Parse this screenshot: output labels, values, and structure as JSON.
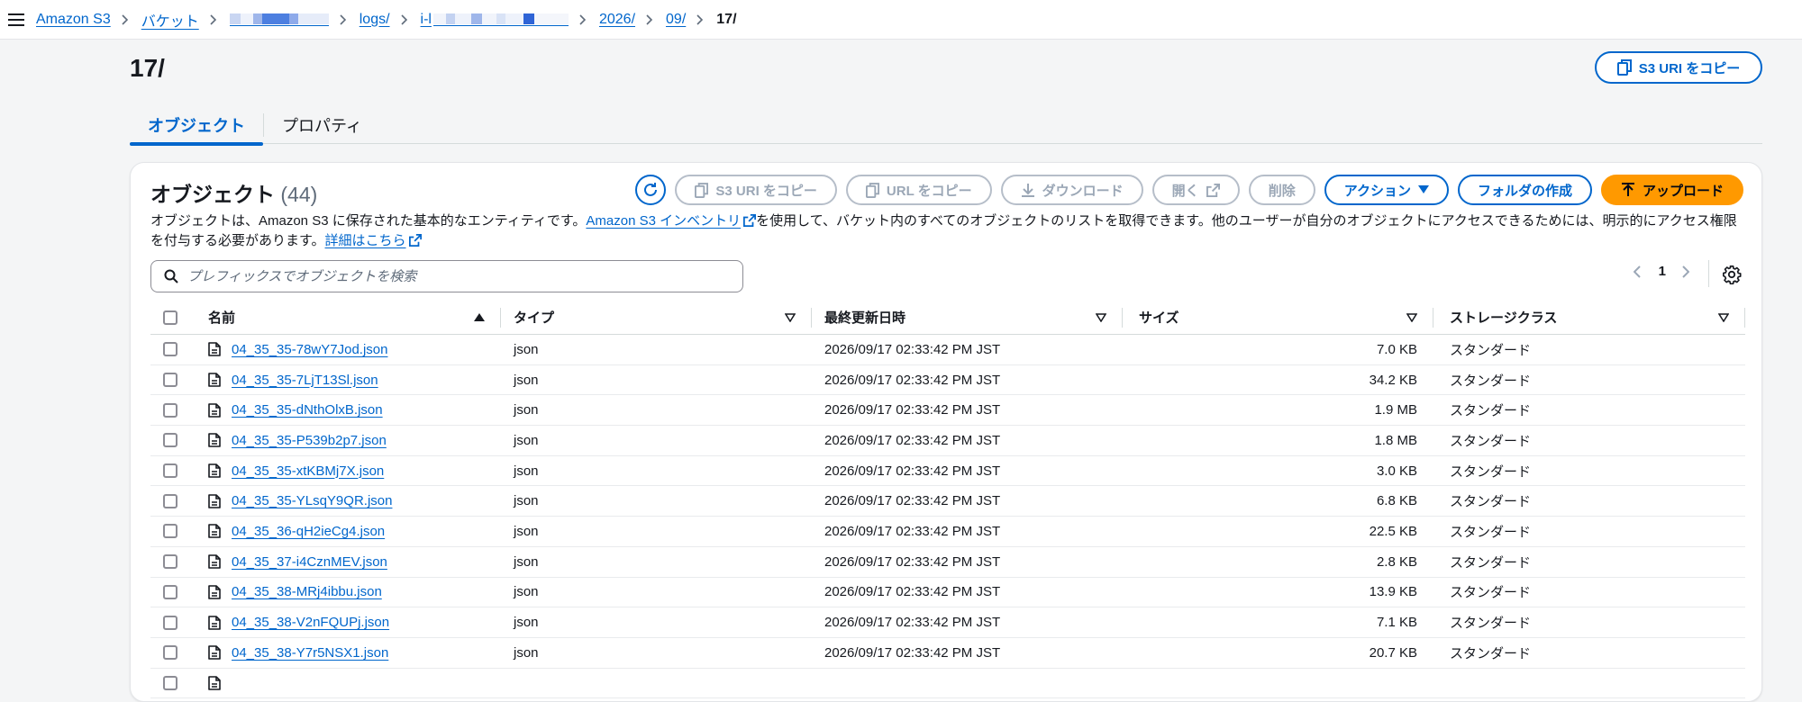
{
  "breadcrumb": {
    "items": [
      {
        "label": "Amazon S3"
      },
      {
        "label": "バケット"
      },
      {
        "label": ""
      },
      {
        "label": "logs/"
      },
      {
        "label": "i-l"
      },
      {
        "label": "2026/"
      },
      {
        "label": "09/"
      }
    ],
    "current": "17/"
  },
  "page": {
    "title": "17/",
    "copy_uri_label": "S3 URI をコピー"
  },
  "tabs": [
    {
      "label": "オブジェクト",
      "active": true
    },
    {
      "label": "プロパティ",
      "active": false
    }
  ],
  "objects": {
    "title": "オブジェクト",
    "count": "(44)",
    "toolbar": {
      "copy_s3_uri": "S3 URI をコピー",
      "copy_url": "URL をコピー",
      "download": "ダウンロード",
      "open": "開く",
      "delete": "削除",
      "actions": "アクション",
      "create_folder": "フォルダの作成",
      "upload": "アップロード"
    },
    "description": {
      "part1": "オブジェクトは、Amazon S3 に保存された基本的なエンティティです。",
      "link1": "Amazon S3 インベントリ",
      "part2": "を使用して、バケット内のすべてのオブジェクトのリストを取得できます。他のユーザーが自分のオブジェクトにアクセスできるためには、明示的にアクセス権限を付与する必要があります。",
      "link2": "詳細はこちら"
    },
    "search_placeholder": "プレフィックスでオブジェクトを検索",
    "page_number": "1",
    "columns": {
      "name": "名前",
      "type": "タイプ",
      "last_modified": "最終更新日時",
      "size": "サイズ",
      "storage_class": "ストレージクラス"
    },
    "rows": [
      {
        "name": "04_35_35-78wY7Jod.json",
        "type": "json",
        "date": "2026/09/17 02:33:42 PM JST",
        "size": "7.0 KB",
        "class": "スタンダード"
      },
      {
        "name": "04_35_35-7LjT13Sl.json",
        "type": "json",
        "date": "2026/09/17 02:33:42 PM JST",
        "size": "34.2 KB",
        "class": "スタンダード"
      },
      {
        "name": "04_35_35-dNthOlxB.json",
        "type": "json",
        "date": "2026/09/17 02:33:42 PM JST",
        "size": "1.9 MB",
        "class": "スタンダード"
      },
      {
        "name": "04_35_35-P539b2p7.json",
        "type": "json",
        "date": "2026/09/17 02:33:42 PM JST",
        "size": "1.8 MB",
        "class": "スタンダード"
      },
      {
        "name": "04_35_35-xtKBMj7X.json",
        "type": "json",
        "date": "2026/09/17 02:33:42 PM JST",
        "size": "3.0 KB",
        "class": "スタンダード"
      },
      {
        "name": "04_35_35-YLsqY9QR.json",
        "type": "json",
        "date": "2026/09/17 02:33:42 PM JST",
        "size": "6.8 KB",
        "class": "スタンダード"
      },
      {
        "name": "04_35_36-qH2ieCg4.json",
        "type": "json",
        "date": "2026/09/17 02:33:42 PM JST",
        "size": "22.5 KB",
        "class": "スタンダード"
      },
      {
        "name": "04_35_37-i4CznMEV.json",
        "type": "json",
        "date": "2026/09/17 02:33:42 PM JST",
        "size": "2.8 KB",
        "class": "スタンダード"
      },
      {
        "name": "04_35_38-MRj4ibbu.json",
        "type": "json",
        "date": "2026/09/17 02:33:42 PM JST",
        "size": "13.9 KB",
        "class": "スタンダード"
      },
      {
        "name": "04_35_38-V2nFQUPj.json",
        "type": "json",
        "date": "2026/09/17 02:33:42 PM JST",
        "size": "7.1 KB",
        "class": "スタンダード"
      },
      {
        "name": "04_35_38-Y7r5NSX1.json",
        "type": "json",
        "date": "2026/09/17 02:33:42 PM JST",
        "size": "20.7 KB",
        "class": "スタンダード"
      },
      {
        "name": "",
        "type": "",
        "date": "",
        "size": "",
        "class": ""
      }
    ]
  },
  "colors": {
    "link": "#0066cc",
    "upload_button": "#ff9900",
    "disabled_border": "#b6bec9"
  }
}
